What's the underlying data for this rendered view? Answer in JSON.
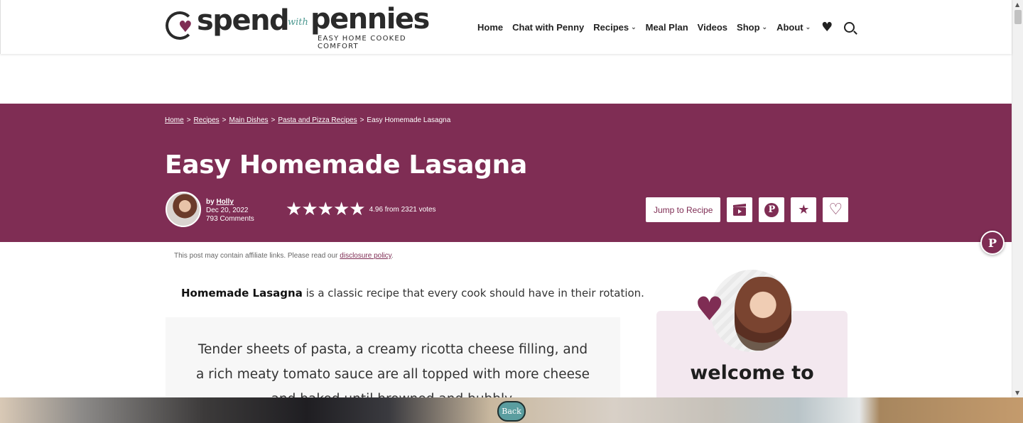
{
  "brand": {
    "spend": "spend",
    "with": "with",
    "pennies": "pennies",
    "tagline": "EASY HOME COOKED COMFORT"
  },
  "nav": {
    "items": [
      {
        "label": "Home",
        "dropdown": false
      },
      {
        "label": "Chat with Penny",
        "dropdown": false
      },
      {
        "label": "Recipes",
        "dropdown": true
      },
      {
        "label": "Meal Plan",
        "dropdown": false
      },
      {
        "label": "Videos",
        "dropdown": false
      },
      {
        "label": "Shop",
        "dropdown": true
      },
      {
        "label": "About",
        "dropdown": true
      }
    ],
    "favorites_icon": "heart-icon",
    "search_icon": "search-icon"
  },
  "breadcrumb": {
    "items": [
      "Home",
      "Recipes",
      "Main Dishes",
      "Pasta and Pizza Recipes"
    ],
    "current": "Easy Homemade Lasagna",
    "separator": ">"
  },
  "post": {
    "title": "Easy Homemade Lasagna",
    "author_prefix": "by",
    "author": "Holly",
    "date": "Dec 20, 2022",
    "comments": "793 Comments",
    "rating_stars": 5,
    "rating_text": "4.96 from 2321 votes"
  },
  "actions": {
    "jump_label": "Jump to Recipe",
    "icons": [
      "video-icon",
      "pinterest-icon",
      "star-icon",
      "heart-outline-icon"
    ]
  },
  "content": {
    "disclosure_prefix": "This post may contain affiliate links. Please read our",
    "disclosure_link": "disclosure policy",
    "disclosure_suffix": ".",
    "intro_bold": "Homemade Lasagna",
    "intro_rest": " is a classic recipe that every cook should have in their rotation.",
    "summary": "Tender sheets of pasta, a creamy ricotta cheese filling, and a rich meaty tomato sauce are all topped with more cheese and baked until browned and bubbly."
  },
  "sidebar": {
    "welcome_title": "welcome to"
  },
  "bottom_banner": {
    "back_label": "Back"
  },
  "colors": {
    "brand": "#7f2d54",
    "accent_teal": "#5a9d9f",
    "welcome_bg": "#f3e8ef"
  }
}
